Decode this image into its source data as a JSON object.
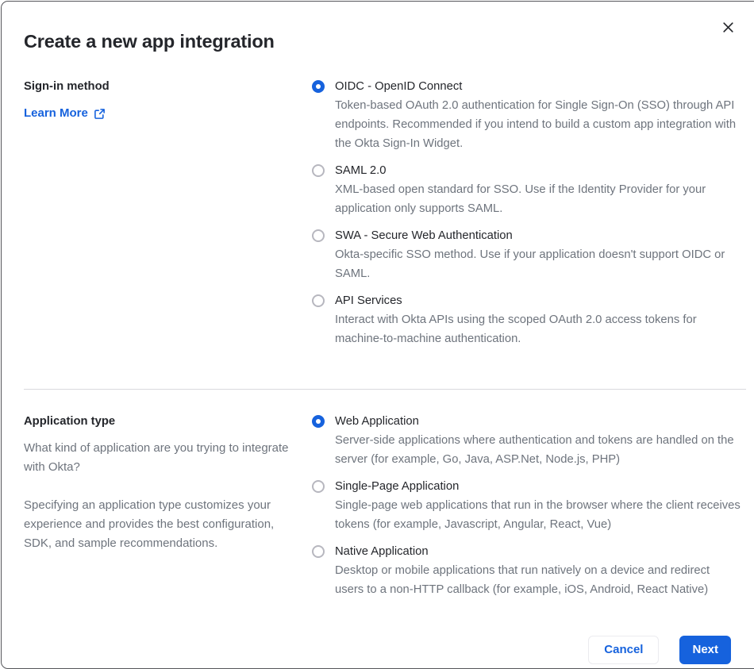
{
  "dialog": {
    "title": "Create a new app integration"
  },
  "signin": {
    "label": "Sign-in method",
    "learn_more_label": "Learn More",
    "options": [
      {
        "label": "OIDC - OpenID Connect",
        "description": "Token-based OAuth 2.0 authentication for Single Sign-On (SSO) through API endpoints. Recommended if you intend to build a custom app integration with the Okta Sign-In Widget.",
        "selected": true
      },
      {
        "label": "SAML 2.0",
        "description": "XML-based open standard for SSO. Use if the Identity Provider for your application only supports SAML.",
        "selected": false
      },
      {
        "label": "SWA - Secure Web Authentication",
        "description": "Okta-specific SSO method. Use if your application doesn't support OIDC or SAML.",
        "selected": false
      },
      {
        "label": "API Services",
        "description": "Interact with Okta APIs using the scoped OAuth 2.0 access tokens for machine-to-machine authentication.",
        "selected": false
      }
    ]
  },
  "apptype": {
    "label": "Application type",
    "intro_1": "What kind of application are you trying to integrate with Okta?",
    "intro_2": "Specifying an application type customizes your experience and provides the best configuration, SDK, and sample recommendations.",
    "options": [
      {
        "label": "Web Application",
        "description": "Server-side applications where authentication and tokens are handled on the server (for example, Go, Java, ASP.Net, Node.js, PHP)",
        "selected": true
      },
      {
        "label": "Single-Page Application",
        "description": "Single-page web applications that run in the browser where the client receives tokens (for example, Javascript, Angular, React, Vue)",
        "selected": false
      },
      {
        "label": "Native Application",
        "description": "Desktop or mobile applications that run natively on a device and redirect users to a non-HTTP callback (for example, iOS, Android, React Native)",
        "selected": false
      }
    ]
  },
  "footer": {
    "cancel_label": "Cancel",
    "next_label": "Next"
  },
  "icons": {
    "close": "x-cross",
    "learn_more": "external-link"
  },
  "colors": {
    "primary_blue": "#1662dd",
    "text_dark": "#24262b",
    "text_gray": "#6e747d",
    "divider": "#d9d9de",
    "dialog_border": "#55565a",
    "radio_unselected_border": "#b7b7bf"
  }
}
